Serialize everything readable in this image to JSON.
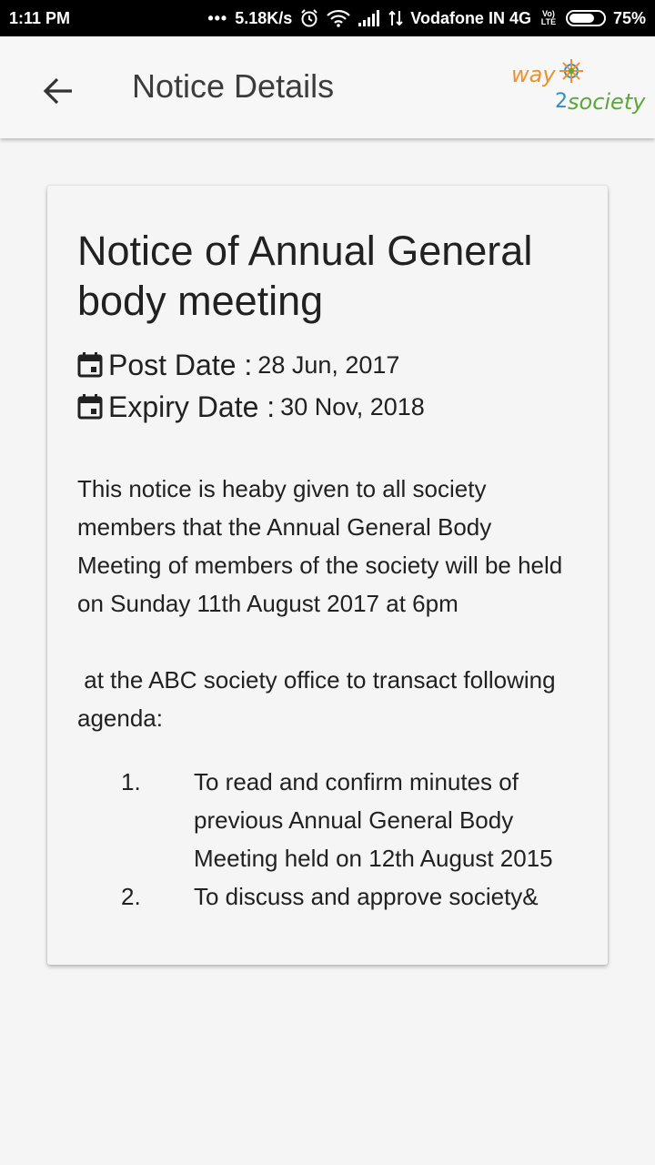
{
  "status_bar": {
    "time": "1:11 PM",
    "dots": "•••",
    "network_speed": "5.18K/s",
    "carrier": "Vodafone IN 4G",
    "volte": "Vo) LTE",
    "battery": "75%",
    "battery_level": 0.75
  },
  "app_bar": {
    "title": "Notice Details",
    "logo_text_top": "way",
    "logo_text_bottom": "2society"
  },
  "notice": {
    "title": "Notice of Annual General body meeting",
    "post_date_label": "Post Date :",
    "post_date_value": "28 Jun, 2017",
    "expiry_date_label": "Expiry Date :",
    "expiry_date_value": "30 Nov, 2018",
    "paragraph_1": "This notice is heaby given to all society members that the Annual General Body Meeting of members of the society will be held on Sunday 11th August 2017 at 6pm",
    "paragraph_2": " at the ABC society office to transact following agenda:",
    "agenda": [
      {
        "number": "1.",
        "text": "To read and confirm minutes of previous Annual General Body Meeting held on 12th August 2015"
      },
      {
        "number": "2.",
        "text": "To discuss and approve society&"
      }
    ]
  },
  "colors": {
    "status_bar_bg": "#000000",
    "background": "#f5f5f5",
    "text_primary": "#212121",
    "title_text": "#3c3c3c",
    "logo_orange": "#f0902a",
    "logo_green": "#5aa83a",
    "logo_blue": "#2a8fd0"
  }
}
